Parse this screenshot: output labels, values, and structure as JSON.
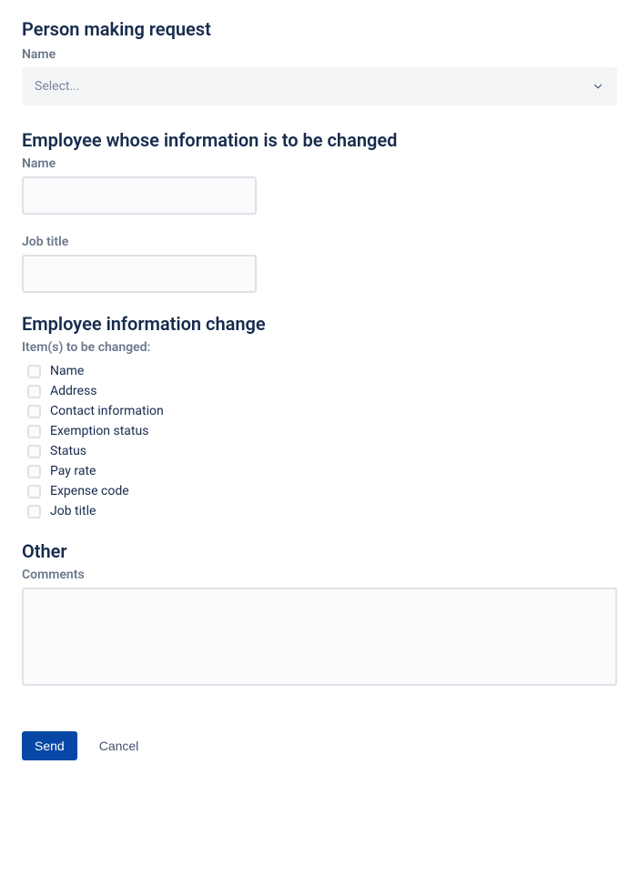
{
  "sections": {
    "requester": {
      "heading": "Person making request",
      "name_label": "Name",
      "select_placeholder": "Select..."
    },
    "employee": {
      "heading": "Employee whose information is to be changed",
      "name_label": "Name",
      "job_title_label": "Job title"
    },
    "change": {
      "heading": "Employee information change",
      "items_label": "Item(s) to be changed:",
      "options": [
        "Name",
        "Address",
        "Contact information",
        "Exemption status",
        "Status",
        "Pay rate",
        "Expense code",
        "Job title"
      ]
    },
    "other": {
      "heading": "Other",
      "comments_label": "Comments"
    }
  },
  "actions": {
    "send": "Send",
    "cancel": "Cancel"
  }
}
